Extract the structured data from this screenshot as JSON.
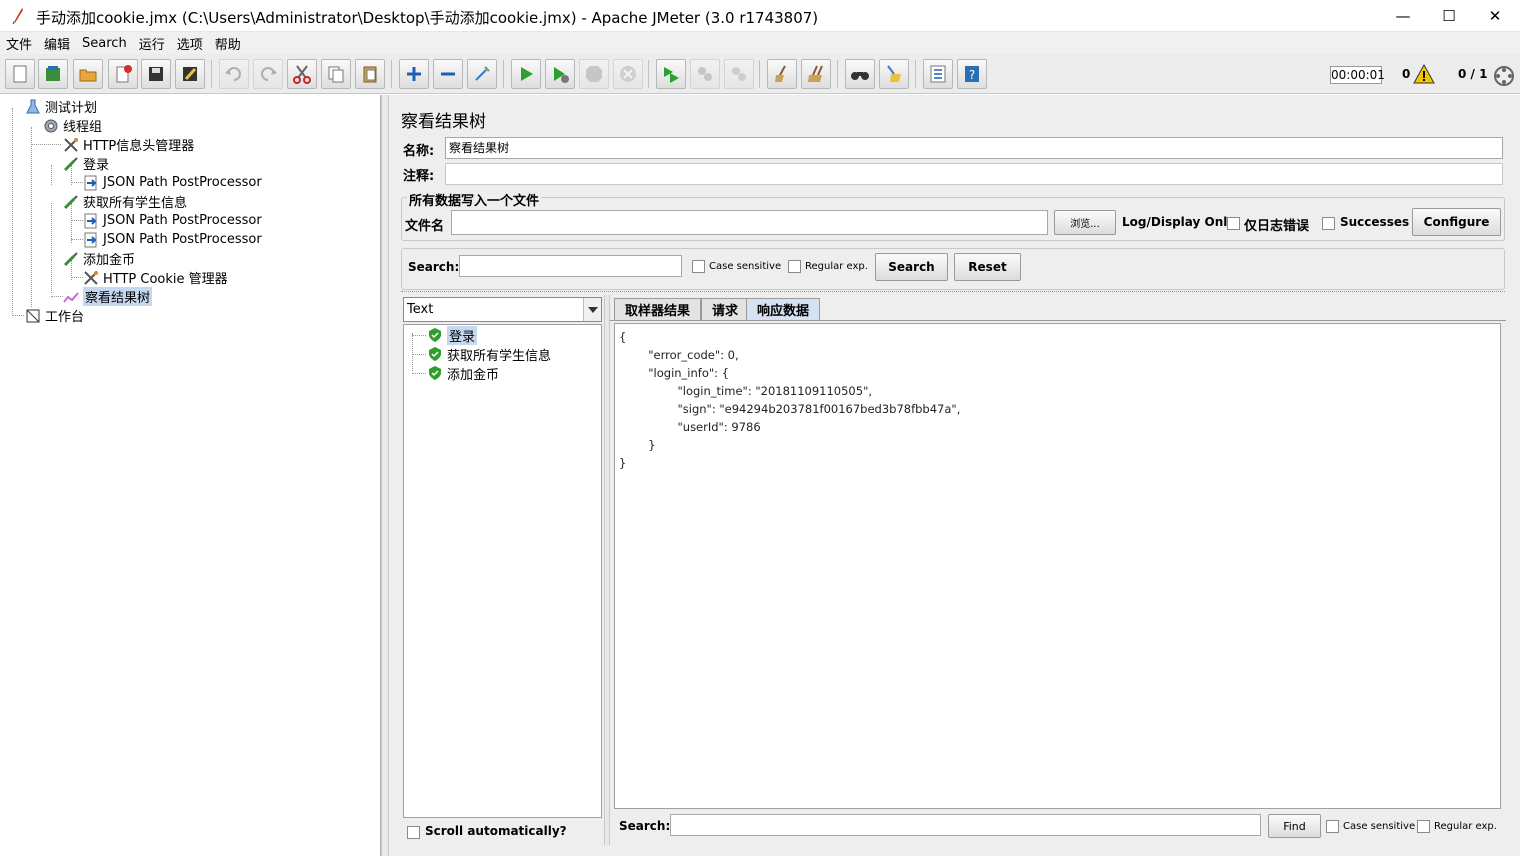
{
  "window": {
    "title": "手动添加cookie.jmx (C:\\Users\\Administrator\\Desktop\\手动添加cookie.jmx) - Apache JMeter (3.0 r1743807)",
    "minimize": "—",
    "maximize": "☐",
    "close": "✕"
  },
  "menu": [
    "文件",
    "编辑",
    "Search",
    "运行",
    "选项",
    "帮助"
  ],
  "status": {
    "timer": "00:00:01",
    "warnings": "0",
    "threads": "0 / 1"
  },
  "tree": {
    "plan": "测试计划",
    "thread_group": "线程组",
    "header_manager": "HTTP信息头管理器",
    "login": "登录",
    "json_pp_1": "JSON Path PostProcessor",
    "get_students": "获取所有学生信息",
    "json_pp_2": "JSON Path PostProcessor",
    "json_pp_3": "JSON Path PostProcessor",
    "add_coins": "添加金币",
    "cookie_manager": "HTTP Cookie 管理器",
    "results_tree": "察看结果树",
    "workbench": "工作台"
  },
  "panel": {
    "title": "察看结果树",
    "name_label": "名称:",
    "name_value": "察看结果树",
    "comment_label": "注释:",
    "comment_value": "",
    "file_group_title": "所有数据写入一个文件",
    "filename_label": "文件名",
    "filename_value": "",
    "browse_label": "浏览...",
    "log_display_label": "Log/Display Only:",
    "errors_only_label": "仅日志错误",
    "successes_label": "Successes",
    "configure_label": "Configure",
    "search_label": "Search:",
    "search_value": "",
    "case_sensitive_label": "Case sensitive",
    "regexp_label": "Regular exp.",
    "search_button": "Search",
    "reset_button": "Reset"
  },
  "results": {
    "renderer": "Text",
    "items": [
      "登录",
      "获取所有学生信息",
      "添加金币"
    ],
    "scroll_auto_label": "Scroll automatically?"
  },
  "tabs": [
    "取样器结果",
    "请求",
    "响应数据"
  ],
  "response_text": "{\n        \"error_code\": 0,\n        \"login_info\": {\n                \"login_time\": \"20181109110505\",\n                \"sign\": \"e94294b203781f00167bed3b78fbb47a\",\n                \"userId\": 9786\n        }\n}",
  "bottom_search": {
    "label": "Search:",
    "value": "",
    "find_button": "Find",
    "case_sensitive_label": "Case sensitive",
    "regexp_label": "Regular exp."
  }
}
